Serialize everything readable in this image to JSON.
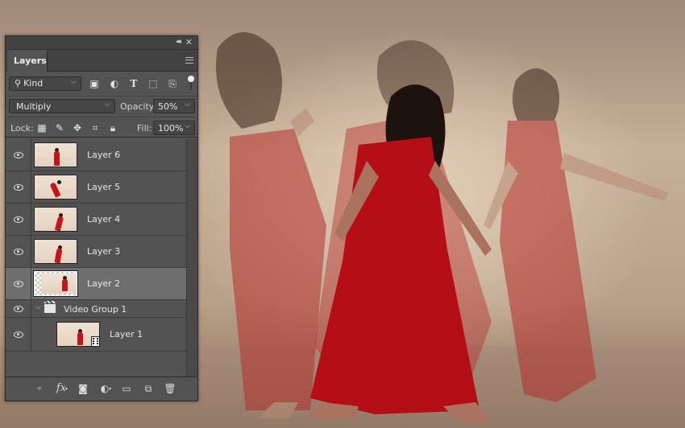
{
  "panel": {
    "tab_label": "Layers",
    "collapse_glyph": "◂◂",
    "close_glyph": "✕"
  },
  "filter": {
    "kind_label": "Kind",
    "icons": [
      "image-filter-icon",
      "adjustment-filter-icon",
      "type-filter-icon",
      "shape-filter-icon",
      "smart-object-filter-icon"
    ]
  },
  "blend": {
    "mode": "Multiply",
    "opacity_label": "Opacity:",
    "opacity_value": "50%"
  },
  "lock": {
    "label": "Lock:",
    "fill_label": "Fill:",
    "fill_value": "100%"
  },
  "layers": [
    {
      "name": "Layer 6",
      "selected": false
    },
    {
      "name": "Layer 5",
      "selected": false
    },
    {
      "name": "Layer 4",
      "selected": false
    },
    {
      "name": "Layer 3",
      "selected": false
    },
    {
      "name": "Layer 2",
      "selected": true
    }
  ],
  "group": {
    "name": "Video Group 1",
    "child": {
      "name": "Layer 1"
    }
  },
  "bottom_icons": [
    "link-layers-icon",
    "fx-icon",
    "add-mask-icon",
    "adjustment-layer-icon",
    "new-group-icon",
    "new-layer-icon",
    "delete-icon"
  ],
  "colors": {
    "panel_bg": "#535353",
    "selected_row": "#6e6e6e",
    "dress_red": "#c4151b"
  }
}
